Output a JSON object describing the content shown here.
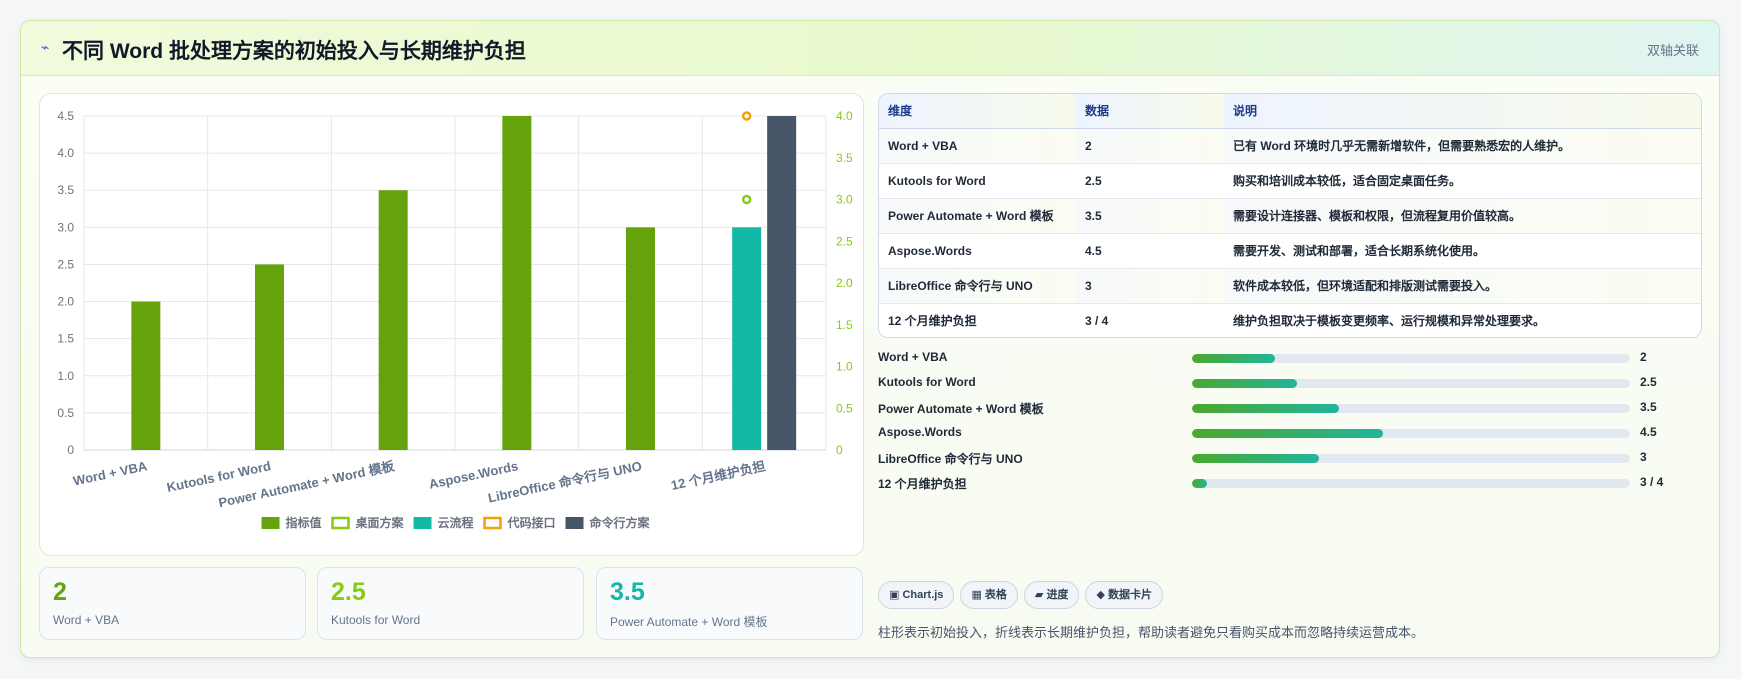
{
  "header": {
    "icon": "lightning-icon",
    "title": "不同 Word 批处理方案的初始投入与长期维护负担",
    "tag": "双轴关联"
  },
  "chart_data": {
    "type": "bar",
    "categories": [
      "Word + VBA",
      "Kutools for Word",
      "Power Automate + Word 模板",
      "Aspose.Words",
      "LibreOffice 命令行与 UNO",
      "12 个月维护负担"
    ],
    "y_left": {
      "min": 0,
      "max": 4.5,
      "ticks": [
        "0",
        "0.5",
        "1.0",
        "1.5",
        "2.0",
        "2.5",
        "3.0",
        "3.5",
        "4.0",
        "4.5"
      ]
    },
    "y_right": {
      "min": 0,
      "max": 4,
      "ticks": [
        "0",
        "0.5",
        "1.0",
        "1.5",
        "2.0",
        "2.5",
        "3.0",
        "3.5",
        "4.0"
      ]
    },
    "series": [
      {
        "name": "指标值",
        "values": [
          2,
          2.5,
          3.5,
          4.5,
          3,
          null
        ],
        "color": "#65a30d",
        "axis": "left"
      },
      {
        "name": "云流程",
        "values": [
          null,
          null,
          null,
          null,
          null,
          3
        ],
        "color": "#14b8a6",
        "axis": "left"
      },
      {
        "name": "命令行方案",
        "values": [
          null,
          null,
          null,
          null,
          null,
          4
        ],
        "color": "#475569",
        "axis": "right"
      },
      {
        "name": "桌面方案",
        "values": [
          null,
          null,
          null,
          null,
          null,
          3
        ],
        "color": "#84cc16",
        "axis": "right",
        "style": "point"
      },
      {
        "name": "代码接口",
        "values": [
          null,
          null,
          null,
          null,
          null,
          4
        ],
        "color": "#f59e0b",
        "axis": "right",
        "style": "point"
      }
    ],
    "legend": [
      {
        "name": "指标值",
        "color": "#65a30d",
        "filled": true
      },
      {
        "name": "桌面方案",
        "color": "#84cc16",
        "filled": false
      },
      {
        "name": "云流程",
        "color": "#14b8a6",
        "filled": true
      },
      {
        "name": "代码接口",
        "color": "#f59e0b",
        "filled": false
      },
      {
        "name": "命令行方案",
        "color": "#475569",
        "filled": true
      }
    ],
    "legend_position": "bottom",
    "grid": true
  },
  "stats": [
    {
      "value": "2",
      "label": "Word + VBA",
      "color": "#65a30d"
    },
    {
      "value": "2.5",
      "label": "Kutools for Word",
      "color": "#84cc16"
    },
    {
      "value": "3.5",
      "label": "Power Automate + Word 模板",
      "color": "#14b8a6"
    }
  ],
  "table": {
    "headers": [
      "维度",
      "数据",
      "说明"
    ],
    "rows": [
      [
        "Word + VBA",
        "2",
        "已有 Word 环境时几乎无需新增软件，但需要熟悉宏的人维护。"
      ],
      [
        "Kutools for Word",
        "2.5",
        "购买和培训成本较低，适合固定桌面任务。"
      ],
      [
        "Power Automate + Word 模板",
        "3.5",
        "需要设计连接器、模板和权限，但流程复用价值较高。"
      ],
      [
        "Aspose.Words",
        "4.5",
        "需要开发、测试和部署，适合长期系统化使用。"
      ],
      [
        "LibreOffice 命令行与 UNO",
        "3",
        "软件成本较低，但环境适配和排版测试需要投入。"
      ],
      [
        "12 个月维护负担",
        "3 / 4",
        "维护负担取决于模板变更频率、运行规模和异常处理要求。"
      ]
    ]
  },
  "progress": [
    {
      "label": "Word + VBA",
      "value_text": "2",
      "fraction": 0.19
    },
    {
      "label": "Kutools for Word",
      "value_text": "2.5",
      "fraction": 0.24
    },
    {
      "label": "Power Automate + Word 模板",
      "value_text": "3.5",
      "fraction": 0.335
    },
    {
      "label": "Aspose.Words",
      "value_text": "4.5",
      "fraction": 0.435
    },
    {
      "label": "LibreOffice 命令行与 UNO",
      "value_text": "3",
      "fraction": 0.29
    },
    {
      "label": "12 个月维护负担",
      "value_text": "3 / 4",
      "fraction": 0.035
    }
  ],
  "chips": [
    {
      "icon": "▣",
      "label": "Chart.js"
    },
    {
      "icon": "▦",
      "label": "表格"
    },
    {
      "icon": "▰",
      "label": "进度"
    },
    {
      "icon": "◆",
      "label": "数据卡片"
    }
  ],
  "footnote": "柱形表示初始投入，折线表示长期维护负担，帮助读者避免只看购买成本而忽略持续运营成本。"
}
